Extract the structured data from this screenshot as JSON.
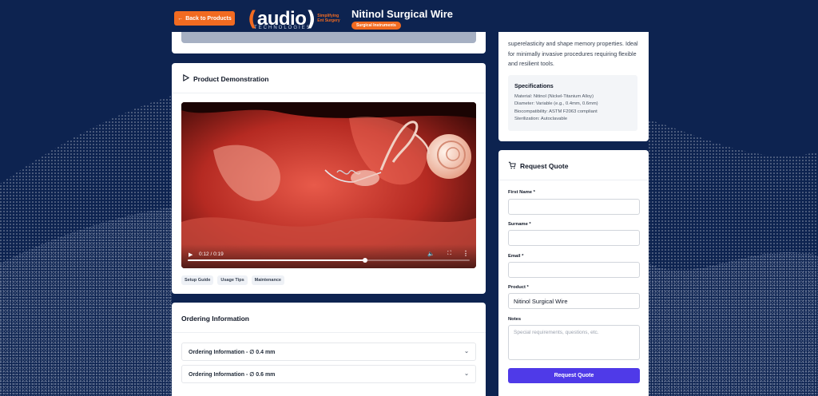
{
  "header": {
    "back_label": "Back to Products",
    "back_arrow": "←",
    "logo": {
      "word": "audio",
      "tagline": "Simplifying Ent Surgery",
      "sub": "TECHNOLOGIES"
    },
    "product_title": "Nitinol Surgical Wire",
    "category_badge": "Surgical Instruments"
  },
  "demo": {
    "heading": "Product Demonstration",
    "icon": "play-outline-icon",
    "video": {
      "time": "0:12 / 0:19",
      "progress": 0.63
    },
    "tags": [
      "Setup Guide",
      "Usage Tips",
      "Maintenance"
    ]
  },
  "ordering": {
    "heading": "Ordering Information",
    "items": [
      {
        "label": "Ordering Information - ∅ 0.4 mm"
      },
      {
        "label": "Ordering Information - ∅ 0.6 mm"
      }
    ]
  },
  "specs": {
    "description": "superelasticity and shape memory properties. Ideal for minimally invasive procedures requiring flexible and resilient tools.",
    "title": "Specifications",
    "lines": [
      "Material: Nitinol (Nickel-Titanium Alloy)",
      "Diameter: Variable (e.g., 0.4mm, 0.6mm)",
      "Biocompatibility: ASTM F2063 compliant",
      "Sterilization: Autoclavable"
    ]
  },
  "quote": {
    "heading": "Request Quote",
    "fields": {
      "first_name_label": "First Name *",
      "first_name_value": "",
      "surname_label": "Surname *",
      "surname_value": "",
      "email_label": "Email *",
      "email_value": "",
      "product_label": "Product *",
      "product_value": "Nitinol Surgical Wire",
      "notes_label": "Notes",
      "notes_placeholder": "Special requirements, questions, etc."
    },
    "submit_label": "Request Quote"
  },
  "colors": {
    "background": "#0d2350",
    "brand_orange": "#f26b21",
    "submit_purple": "#4f3ae8"
  }
}
